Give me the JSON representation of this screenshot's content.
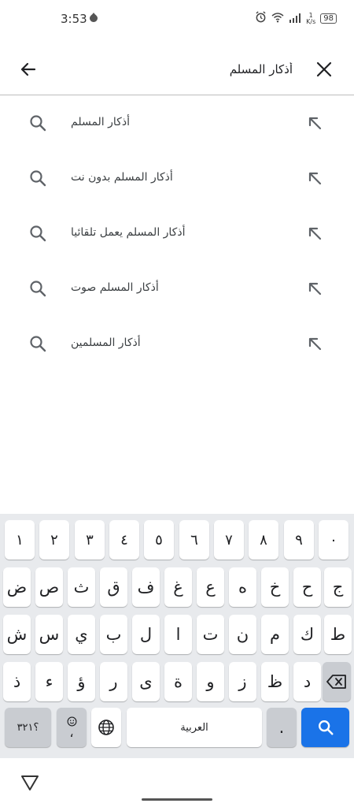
{
  "status": {
    "time": "3:53",
    "speed_value": "1",
    "speed_unit": "K/s",
    "battery": "98"
  },
  "search": {
    "query": "أذكار المسلم"
  },
  "suggestions": [
    "أذكار المسلم",
    "أذكار المسلم بدون نت",
    "أذكار المسلم يعمل تلقائيا",
    "أذكار المسلم صوت",
    "أذكار المسلمين"
  ],
  "keyboard": {
    "numbers": [
      "١",
      "٢",
      "٣",
      "٤",
      "٥",
      "٦",
      "٧",
      "٨",
      "٩",
      "٠"
    ],
    "row1": [
      "ض",
      "ص",
      "ث",
      "ق",
      "ف",
      "غ",
      "ع",
      "ه",
      "خ",
      "ح",
      "ج"
    ],
    "row2": [
      "ش",
      "س",
      "ي",
      "ب",
      "ل",
      "ا",
      "ت",
      "ن",
      "م",
      "ك",
      "ط"
    ],
    "row3": [
      "ذ",
      "ء",
      "ؤ",
      "ر",
      "ى",
      "ة",
      "و",
      "ز",
      "ظ",
      "د"
    ],
    "symbols_label": "؟٣٢١",
    "comma": "،",
    "space_label": "العربية",
    "period": "."
  },
  "colors": {
    "accent": "#1a73e8",
    "keyboard_bg": "#e8eaed",
    "icon": "#5f6368"
  }
}
